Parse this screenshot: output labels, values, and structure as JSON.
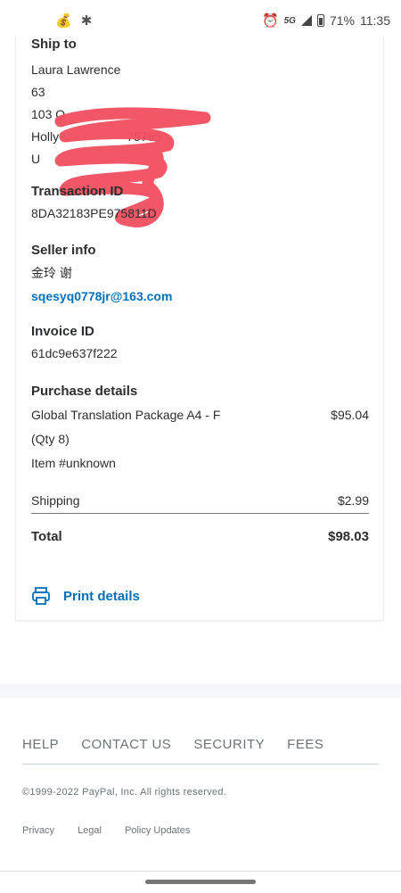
{
  "status_bar": {
    "left_icons": [
      "money-bag-icon",
      "bug-icon"
    ],
    "alarm_icon": "alarm-icon",
    "network": "5G",
    "battery": "71%",
    "time": "11:35"
  },
  "ship_to": {
    "label": "Ship to",
    "lines": [
      "Laura Lawrence",
      "63",
      "103 Q",
      "Holly",
      "U"
    ],
    "partial_postal": "75765"
  },
  "transaction": {
    "label": "Transaction ID",
    "value": "8DA32183PE975811D"
  },
  "seller": {
    "label": "Seller info",
    "name": "金玲 谢",
    "email": "sqesyq0778jr@163.com"
  },
  "invoice": {
    "label": "Invoice ID",
    "value": "61dc9e637f222"
  },
  "purchase": {
    "label": "Purchase details",
    "item_name": "Global Translation Package A4 - F",
    "item_price": "$95.04",
    "qty": "(Qty 8)",
    "item_number": "Item #unknown",
    "shipping_label": "Shipping",
    "shipping_value": "$2.99",
    "total_label": "Total",
    "total_value": "$98.03"
  },
  "print": {
    "label": "Print details",
    "icon": "printer-icon"
  },
  "footer": {
    "links": [
      "HELP",
      "CONTACT US",
      "SECURITY",
      "FEES"
    ],
    "copyright": "©1999-2022 PayPal, Inc. All rights reserved.",
    "small_links": [
      "Privacy",
      "Legal",
      "Policy Updates"
    ]
  },
  "colors": {
    "link_blue": "#0070ba",
    "redaction_red": "#f04e5e"
  }
}
